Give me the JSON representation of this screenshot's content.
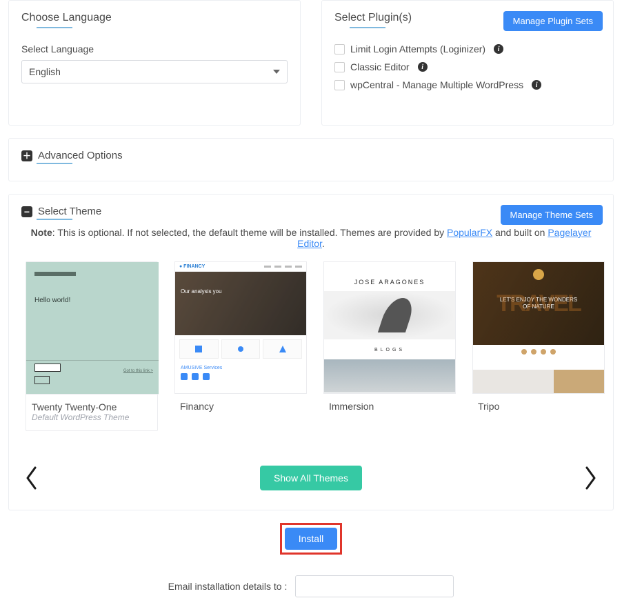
{
  "language": {
    "title": "Choose Language",
    "label": "Select Language",
    "value": "English"
  },
  "plugins": {
    "title": "Select Plugin(s)",
    "manage_btn": "Manage Plugin Sets",
    "items": [
      {
        "label": "Limit Login Attempts (Loginizer)"
      },
      {
        "label": "Classic Editor"
      },
      {
        "label": "wpCentral - Manage Multiple WordPress"
      }
    ]
  },
  "advanced": {
    "title": "Advanced Options"
  },
  "theme": {
    "title": "Select Theme",
    "manage_btn": "Manage Theme Sets",
    "note_lead": "Note",
    "note_text_1": ": This is optional. If not selected, the default theme will be installed. Themes are provided by ",
    "link_popularfx": "PopularFX",
    "note_text_2": " and built on ",
    "link_pagelayer": "Pagelayer Editor",
    "note_tail": ".",
    "cards": [
      {
        "name": "Twenty Twenty-One",
        "subtitle": "Default WordPress Theme",
        "thumb_hello": "Hello world!",
        "thumb_search_link": "Got to this link >"
      },
      {
        "name": "Financy",
        "thumb_logo": "● FINANCY",
        "thumb_hero": "Our analysis you",
        "thumb_svc": "AMUSIVE Services"
      },
      {
        "name": "Immersion",
        "thumb_name": "JOSE ARAGONES",
        "thumb_blogs": "BLOGS"
      },
      {
        "name": "Tripo",
        "thumb_line1": "LET'S ENJOY THE WONDERS",
        "thumb_line2": "OF NATURE",
        "thumb_bg": "TRAVEL"
      }
    ],
    "show_all_btn": "Show All Themes"
  },
  "install_btn": "Install",
  "email_label": "Email installation details to :"
}
